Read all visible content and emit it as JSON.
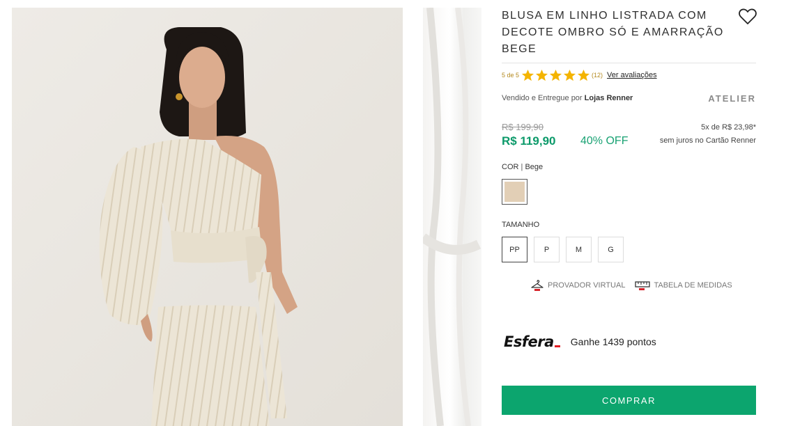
{
  "product": {
    "title": "BLUSA EM LINHO LISTRADA COM DECOTE OMBRO SÓ E AMARRAÇÃO BEGE",
    "rating_text": "5 de 5",
    "rating_value": 5,
    "rating_max": 5,
    "reviews_count": "(12)",
    "reviews_link": "Ver avaliações",
    "seller_prefix": "Vendido e Entregue por",
    "seller_name": "Lojas Renner",
    "brand": "ATELIER"
  },
  "price": {
    "old": "R$ 199,90",
    "current": "R$ 119,90",
    "discount": "40% OFF",
    "installments": "5x de R$ 23,98*",
    "installments_note": "sem juros no Cartão Renner"
  },
  "color": {
    "label": "COR",
    "separator": "|",
    "selected": "Bege",
    "swatch_hex": "#e2cfb6"
  },
  "size": {
    "label": "TAMANHO",
    "options": [
      "PP",
      "P",
      "M",
      "G"
    ],
    "selected": "PP"
  },
  "tools": {
    "virtual_fitting": "PROVADOR VIRTUAL",
    "size_chart": "TABELA DE MEDIDAS"
  },
  "loyalty": {
    "logo": "Esfera",
    "text": "Ganhe 1439 pontos"
  },
  "buy_button": "COMPRAR",
  "colors": {
    "accent_green": "#0ca56e",
    "price_green": "#0c9a6a",
    "star_gold": "#f4b400"
  },
  "icons": [
    "heart-icon",
    "star-icon",
    "hanger-icon",
    "measuring-tape-icon"
  ]
}
